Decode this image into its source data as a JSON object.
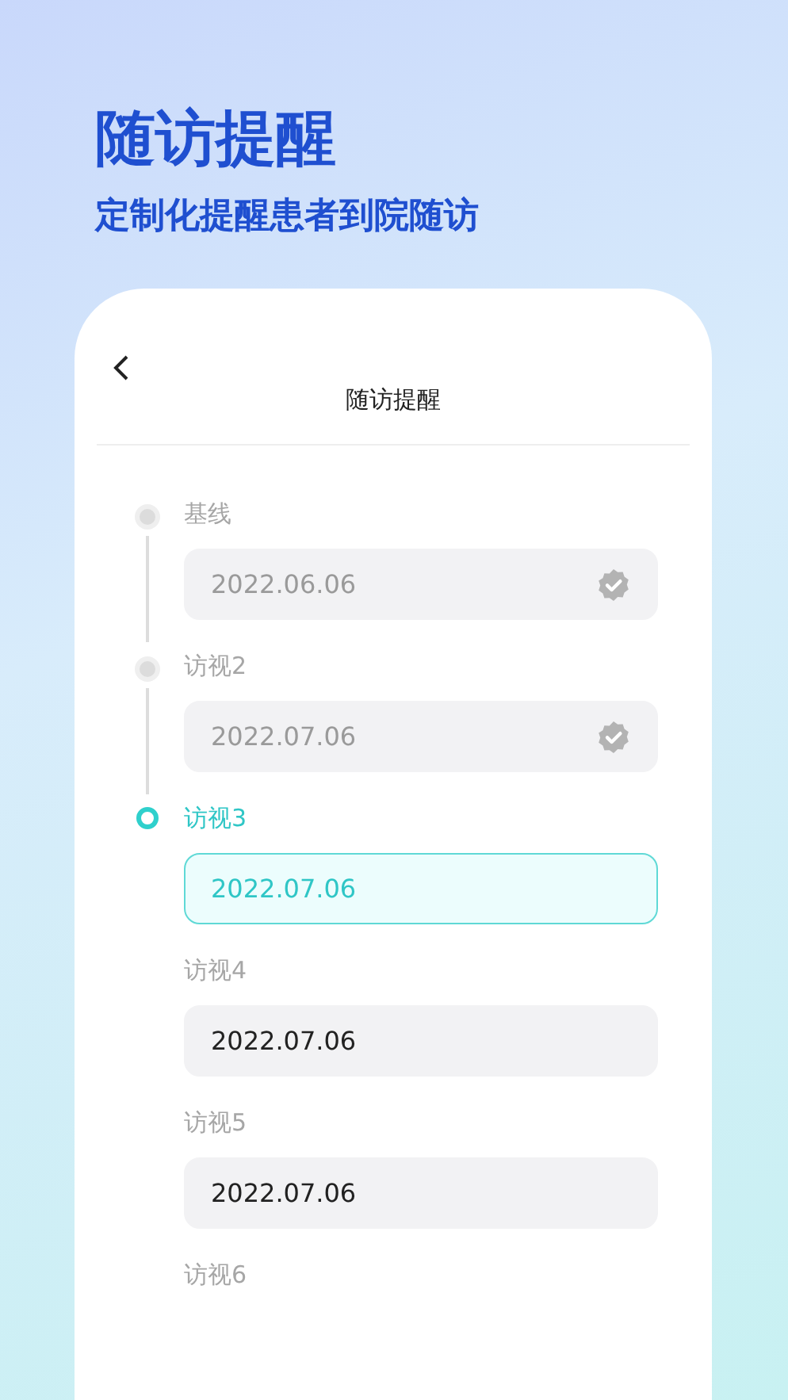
{
  "headline": {
    "title": "随访提醒",
    "subtitle": "定制化提醒患者到院随访"
  },
  "screen": {
    "title": "随访提醒",
    "visits": [
      {
        "label": "基线",
        "date": "2022.06.06",
        "kind": "done"
      },
      {
        "label": "访视2",
        "date": "2022.07.06",
        "kind": "done"
      },
      {
        "label": "访视3",
        "date": "2022.07.06",
        "kind": "current"
      },
      {
        "label": "访视4",
        "date": "2022.07.06",
        "kind": "upcoming"
      },
      {
        "label": "访视5",
        "date": "2022.07.06",
        "kind": "upcoming"
      },
      {
        "label": "访视6",
        "kind": "upcoming"
      }
    ]
  }
}
